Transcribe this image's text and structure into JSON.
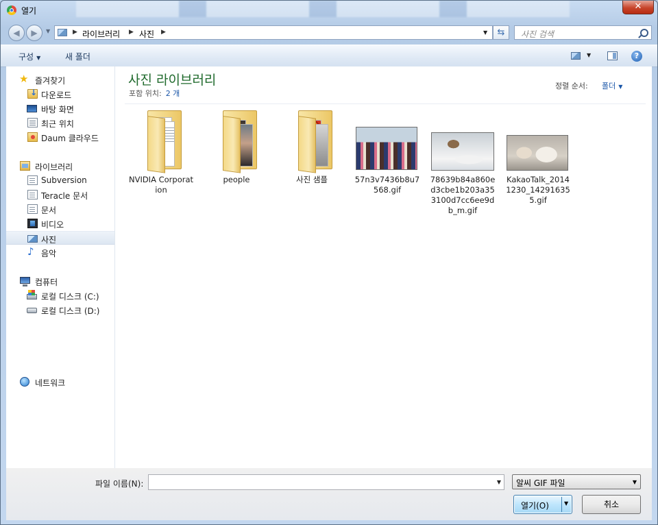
{
  "window": {
    "title": "열기",
    "close": "✕"
  },
  "address": {
    "crumbs": [
      "라이브러리",
      "사진"
    ],
    "search_placeholder": "사진 검색"
  },
  "toolbar": {
    "organize": "구성",
    "new_folder": "새 폴더",
    "help": "?"
  },
  "sidebar": {
    "favorites": {
      "label": "즐겨찾기",
      "items": [
        "다운로드",
        "바탕 화면",
        "최근 위치",
        "Daum 클라우드"
      ]
    },
    "libraries": {
      "label": "라이브러리",
      "items": [
        "Subversion",
        "Teracle 문서",
        "문서",
        "비디오",
        "사진",
        "음악"
      ],
      "selected": "사진"
    },
    "computer": {
      "label": "컴퓨터",
      "items": [
        "로컬 디스크 (C:)",
        "로컬 디스크 (D:)"
      ]
    },
    "network": {
      "label": "네트워크"
    }
  },
  "main": {
    "title": "사진 라이브러리",
    "includes_label": "포함 위치:",
    "includes_value": "2 개",
    "sort_label": "정렬 순서:",
    "sort_value": "폴더",
    "items": [
      {
        "name": "NVIDIA Corporation",
        "kind": "folder"
      },
      {
        "name": "people",
        "kind": "folder"
      },
      {
        "name": "사진 샘플",
        "kind": "folder"
      },
      {
        "name": "57n3v7436b8u7568.gif",
        "kind": "image"
      },
      {
        "name": "78639b84a860ed3cbe1b203a353100d7cc6ee9db_m.gif",
        "kind": "image"
      },
      {
        "name": "KakaoTalk_20141230_142916355.gif",
        "kind": "image"
      }
    ]
  },
  "bottom": {
    "filename_label": "파일 이름(N):",
    "filename_value": "",
    "filetype": "알씨 GIF 파일",
    "open_label": "열기(O)",
    "cancel_label": "취소"
  },
  "colors": {
    "title_green": "#1f6a2c",
    "link_blue": "#1a56a8",
    "selection": "#dde7f2"
  }
}
